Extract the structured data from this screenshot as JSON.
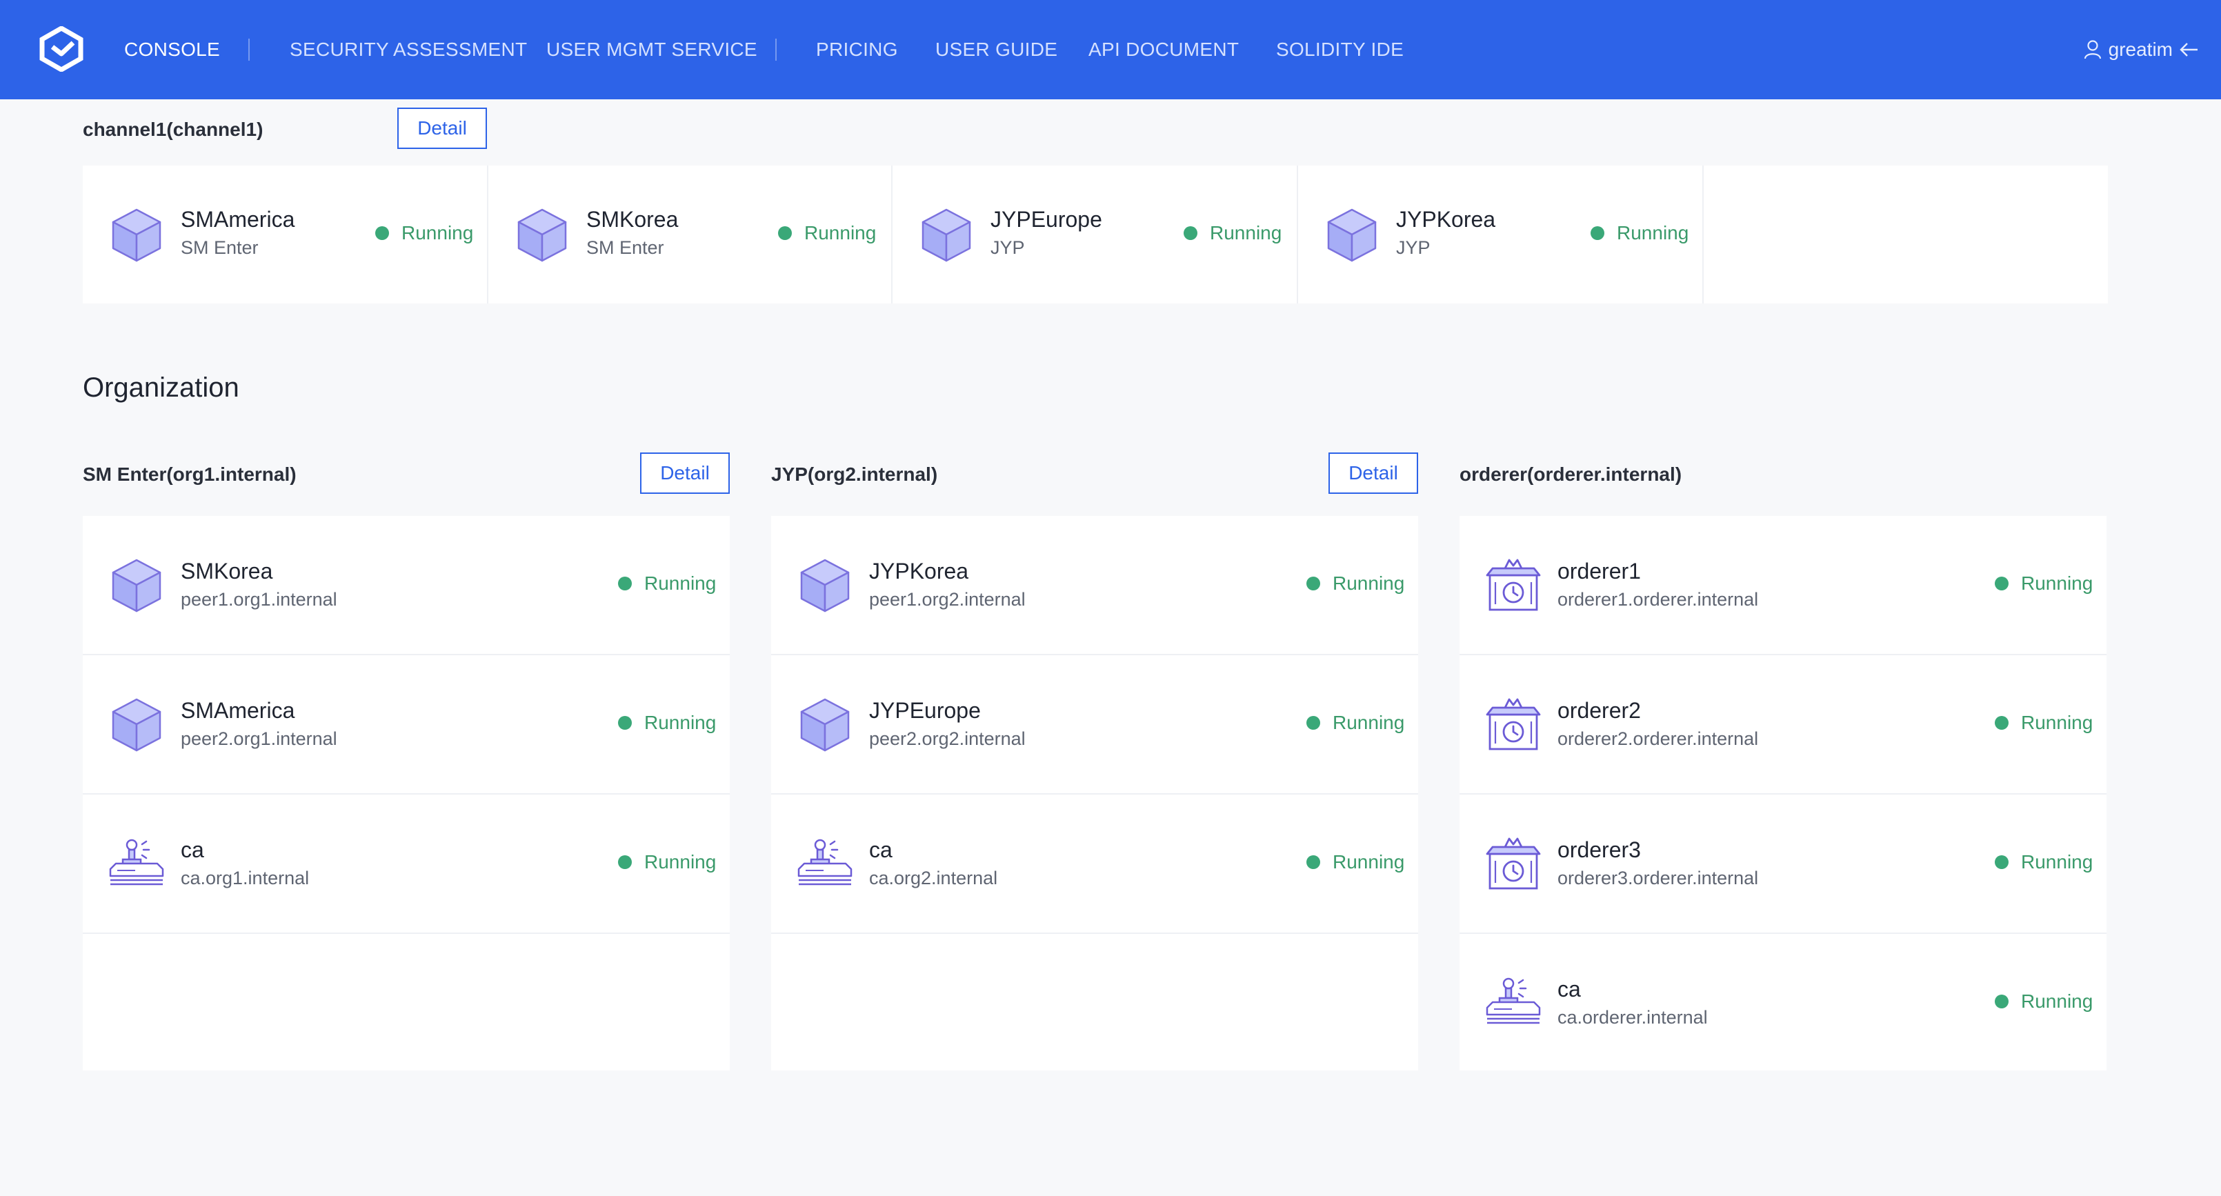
{
  "nav": {
    "items": [
      "CONSOLE",
      "SECURITY ASSESSMENT",
      "USER MGMT SERVICE",
      "PRICING",
      "USER GUIDE",
      "API DOCUMENT",
      "SOLIDITY IDE"
    ],
    "user": "greatim"
  },
  "channel": {
    "title": "channel1(channel1)",
    "detail_label": "Detail",
    "peers": [
      {
        "name": "SMAmerica",
        "sub": "SM Enter",
        "status": "Running",
        "icon": "cube-icon"
      },
      {
        "name": "SMKorea",
        "sub": "SM Enter",
        "status": "Running",
        "icon": "cube-icon"
      },
      {
        "name": "JYPEurope",
        "sub": "JYP",
        "status": "Running",
        "icon": "cube-icon"
      },
      {
        "name": "JYPKorea",
        "sub": "JYP",
        "status": "Running",
        "icon": "cube-icon"
      }
    ]
  },
  "organization": {
    "heading": "Organization",
    "orgs": [
      {
        "title": "SM Enter(org1.internal)",
        "detail_label": "Detail",
        "nodes": [
          {
            "name": "SMKorea",
            "sub": "peer1.org1.internal",
            "status": "Running",
            "icon": "cube-icon"
          },
          {
            "name": "SMAmerica",
            "sub": "peer2.org1.internal",
            "status": "Running",
            "icon": "cube-icon"
          },
          {
            "name": "ca",
            "sub": "ca.org1.internal",
            "status": "Running",
            "icon": "stamp-icon"
          }
        ]
      },
      {
        "title": "JYP(org2.internal)",
        "detail_label": "Detail",
        "nodes": [
          {
            "name": "JYPKorea",
            "sub": "peer1.org2.internal",
            "status": "Running",
            "icon": "cube-icon"
          },
          {
            "name": "JYPEurope",
            "sub": "peer2.org2.internal",
            "status": "Running",
            "icon": "cube-icon"
          },
          {
            "name": "ca",
            "sub": "ca.org2.internal",
            "status": "Running",
            "icon": "stamp-icon"
          }
        ]
      },
      {
        "title": "orderer(orderer.internal)",
        "nodes": [
          {
            "name": "orderer1",
            "sub": "orderer1.orderer.internal",
            "status": "Running",
            "icon": "orderer-icon"
          },
          {
            "name": "orderer2",
            "sub": "orderer2.orderer.internal",
            "status": "Running",
            "icon": "orderer-icon"
          },
          {
            "name": "orderer3",
            "sub": "orderer3.orderer.internal",
            "status": "Running",
            "icon": "orderer-icon"
          },
          {
            "name": "ca",
            "sub": "ca.orderer.internal",
            "status": "Running",
            "icon": "stamp-icon"
          }
        ]
      }
    ]
  },
  "colors": {
    "brand": "#2d63e8",
    "status_green": "#3aa878",
    "icon_purple": "#6b5bd6"
  }
}
